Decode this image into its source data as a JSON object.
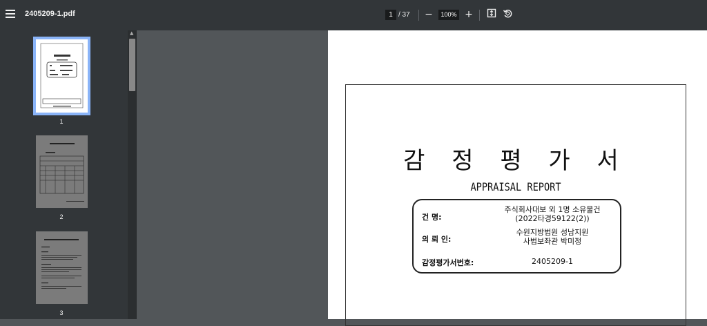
{
  "toolbar": {
    "file_name": "2405209-1.pdf",
    "current_page": "1",
    "total_pages": "/ 37",
    "zoom_out": "−",
    "zoom": "100%",
    "zoom_in": "+",
    "fit_icon": "fit-page-icon",
    "rotate_icon": "rotate-icon",
    "menu_icon": "menu-icon"
  },
  "sidebar": {
    "thumbnails": [
      {
        "label": "1",
        "selected": true
      },
      {
        "label": "2",
        "selected": false
      },
      {
        "label": "3",
        "selected": false
      }
    ]
  },
  "document": {
    "title": "감 정 평 가 서",
    "subtitle": "APPRAISAL REPORT",
    "case_label": "건          명:",
    "case_value_1": "주식회사대보 외 1명 소유물건",
    "case_value_2": "(2022타경59122(2))",
    "requester_label": "의    뢰    인:",
    "requester_value_1": "수원지방법원 성남지원",
    "requester_value_2": "사법보좌관 박미정",
    "report_no_label": "감정평가서번호:",
    "report_no_value": "2405209-1"
  }
}
